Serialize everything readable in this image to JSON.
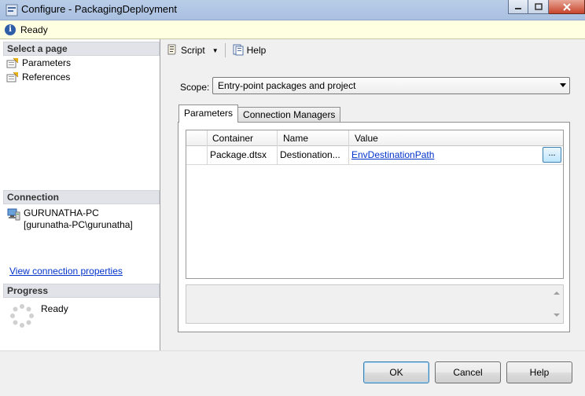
{
  "window": {
    "title": "Configure - PackagingDeployment"
  },
  "status": {
    "text": "Ready"
  },
  "left": {
    "select_page_header": "Select a page",
    "pages": [
      {
        "label": "Parameters"
      },
      {
        "label": "References"
      }
    ],
    "connection_header": "Connection",
    "server": "GURUNATHA-PC",
    "user": "[gurunatha-PC\\gurunatha]",
    "view_connection_link": "View connection properties",
    "progress_header": "Progress",
    "progress_text": "Ready"
  },
  "toolbar": {
    "script_label": "Script",
    "help_label": "Help"
  },
  "scope": {
    "label": "Scope:",
    "value": "Entry-point packages and project"
  },
  "tabs": [
    {
      "label": "Parameters",
      "active": true
    },
    {
      "label": "Connection Managers",
      "active": false
    }
  ],
  "grid": {
    "columns": [
      "Container",
      "Name",
      "Value"
    ],
    "rows": [
      {
        "container": "Package.dtsx",
        "name": "Destionation...",
        "value": "EnvDestinationPath"
      }
    ],
    "ellipsis_label": "..."
  },
  "buttons": {
    "ok": "OK",
    "cancel": "Cancel",
    "help": "Help"
  }
}
